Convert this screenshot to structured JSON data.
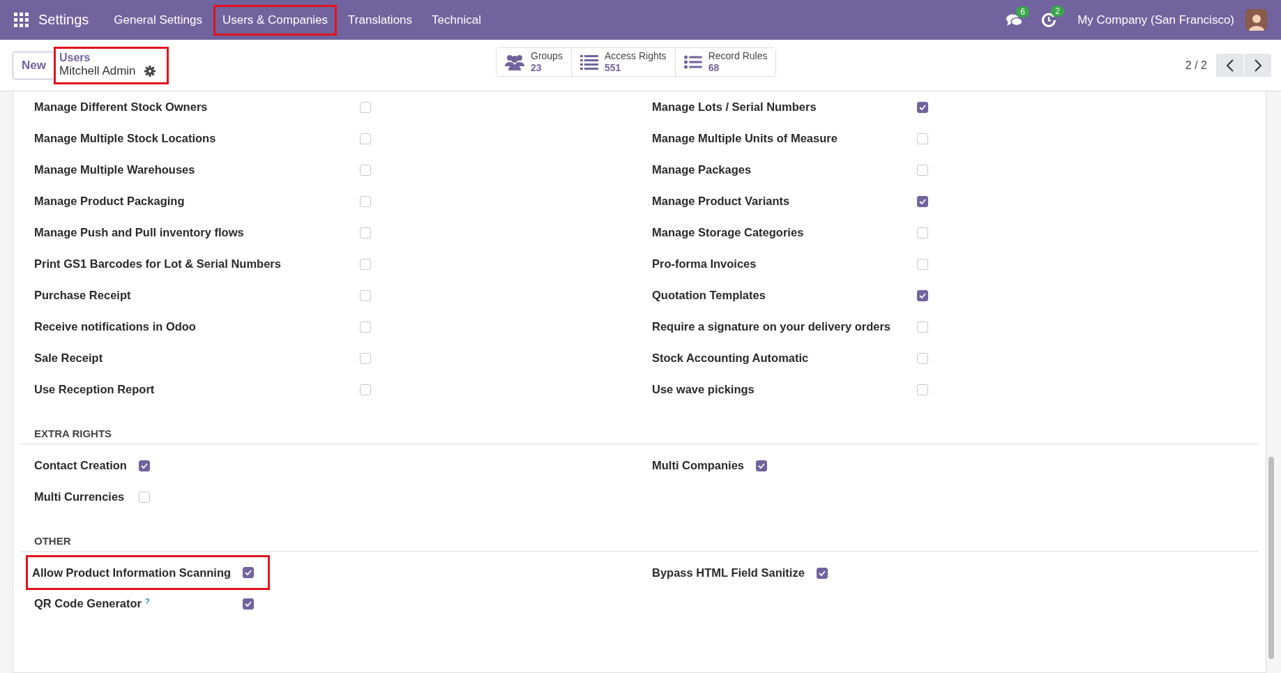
{
  "navbar": {
    "app_title": "Settings",
    "menu": [
      {
        "label": "General Settings",
        "highlighted": false
      },
      {
        "label": "Users & Companies",
        "highlighted": true
      },
      {
        "label": "Translations",
        "highlighted": false
      },
      {
        "label": "Technical",
        "highlighted": false
      }
    ],
    "messages_badge": "6",
    "activities_badge": "2",
    "company": "My Company (San Francisco)"
  },
  "control_panel": {
    "new_button": "New",
    "breadcrumb": {
      "parent": "Users",
      "current": "Mitchell Admin",
      "highlighted": true
    },
    "stat_buttons": [
      {
        "kind": "groups",
        "label": "Groups",
        "value": "23"
      },
      {
        "kind": "list",
        "label": "Access Rights",
        "value": "551"
      },
      {
        "kind": "rules",
        "label": "Record Rules",
        "value": "68"
      }
    ],
    "pager": "2 / 2"
  },
  "sections": [
    {
      "items": [
        {
          "label": "Manage Different Stock Owners",
          "checked": false,
          "highlighted": false
        },
        {
          "label": "Manage Lots / Serial Numbers",
          "checked": true,
          "highlighted": false
        },
        {
          "label": "Manage Multiple Stock Locations",
          "checked": false,
          "highlighted": false
        },
        {
          "label": "Manage Multiple Units of Measure",
          "checked": false,
          "highlighted": false
        },
        {
          "label": "Manage Multiple Warehouses",
          "checked": false,
          "highlighted": false
        },
        {
          "label": "Manage Packages",
          "checked": false,
          "highlighted": false
        },
        {
          "label": "Manage Product Packaging",
          "checked": false,
          "highlighted": false
        },
        {
          "label": "Manage Product Variants",
          "checked": true,
          "highlighted": false
        },
        {
          "label": "Manage Push and Pull inventory flows",
          "checked": false,
          "highlighted": false
        },
        {
          "label": "Manage Storage Categories",
          "checked": false,
          "highlighted": false
        },
        {
          "label": "Print GS1 Barcodes for Lot & Serial Numbers",
          "checked": false,
          "highlighted": false
        },
        {
          "label": "Pro-forma Invoices",
          "checked": false,
          "highlighted": false
        },
        {
          "label": "Purchase Receipt",
          "checked": false,
          "highlighted": false
        },
        {
          "label": "Quotation Templates",
          "checked": true,
          "highlighted": false
        },
        {
          "label": "Receive notifications in Odoo",
          "checked": false,
          "highlighted": false
        },
        {
          "label": "Require a signature on your delivery orders",
          "checked": false,
          "highlighted": false
        },
        {
          "label": "Sale Receipt",
          "checked": false,
          "highlighted": false
        },
        {
          "label": "Stock Accounting Automatic",
          "checked": false,
          "highlighted": false
        },
        {
          "label": "Use Reception Report",
          "checked": false,
          "highlighted": false
        },
        {
          "label": "Use wave pickings",
          "checked": false,
          "highlighted": false
        }
      ]
    },
    {
      "title": "EXTRA RIGHTS",
      "items": [
        {
          "label": "Contact Creation",
          "checked": true,
          "highlighted": false
        },
        {
          "label": "Multi Companies",
          "checked": true,
          "highlighted": false
        },
        {
          "label": "Multi Currencies",
          "checked": false,
          "highlighted": false
        }
      ]
    },
    {
      "title": "OTHER",
      "items": [
        {
          "label": "Allow Product Information Scanning",
          "checked": true,
          "highlighted": true
        },
        {
          "label": "Bypass HTML Field Sanitize",
          "checked": true,
          "highlighted": false
        },
        {
          "label": "QR Code Generator",
          "help": "?",
          "checked": true,
          "highlighted": false
        }
      ]
    }
  ]
}
